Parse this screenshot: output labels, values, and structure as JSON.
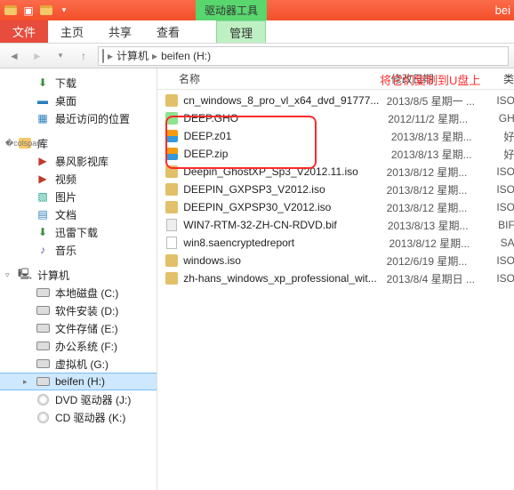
{
  "titlebar": {
    "context_tool": "驱动器工具",
    "right_text": "bei"
  },
  "ribbon": {
    "file": "文件",
    "tabs": [
      "主页",
      "共享",
      "查看"
    ],
    "manage": "管理"
  },
  "address": {
    "computer": "计算机",
    "folder": "beifen (H:)"
  },
  "annotation": "将它们复制到U盘上",
  "columns": {
    "name": "名称",
    "date": "修改日期",
    "type": "类"
  },
  "nav": {
    "quick": [
      {
        "icon": "dl",
        "label": "下载"
      },
      {
        "icon": "desk",
        "label": "桌面"
      },
      {
        "icon": "recent",
        "label": "最近访问的位置"
      }
    ],
    "lib_label": "库",
    "libs": [
      {
        "icon": "vid",
        "label": "暴风影视库"
      },
      {
        "icon": "vid",
        "label": "视频"
      },
      {
        "icon": "pic",
        "label": "图片"
      },
      {
        "icon": "doc",
        "label": "文档"
      },
      {
        "icon": "dl",
        "label": "迅雷下载"
      },
      {
        "icon": "mus",
        "label": "音乐"
      }
    ],
    "pc_label": "计算机",
    "drives": [
      {
        "icon": "drv",
        "label": "本地磁盘 (C:)"
      },
      {
        "icon": "drv",
        "label": "软件安装 (D:)"
      },
      {
        "icon": "drv",
        "label": "文件存储 (E:)"
      },
      {
        "icon": "drv",
        "label": "办公系统 (F:)"
      },
      {
        "icon": "drv",
        "label": "虚拟机 (G:)"
      },
      {
        "icon": "drv",
        "label": "beifen (H:)",
        "selected": true
      },
      {
        "icon": "dvd",
        "label": "DVD 驱动器 (J:)"
      },
      {
        "icon": "dvd",
        "label": "CD 驱动器 (K:)"
      }
    ]
  },
  "files": [
    {
      "icon": "disc",
      "name": "cn_windows_8_pro_vl_x64_dvd_91777...",
      "date": "2013/8/5 星期一 ...",
      "type": "ISO"
    },
    {
      "icon": "gho",
      "name": "DEEP.GHO",
      "date": "2012/11/2 星期...",
      "type": "GH"
    },
    {
      "icon": "zip",
      "name": "DEEP.z01",
      "date": "2013/8/13 星期...",
      "type": "好"
    },
    {
      "icon": "zip",
      "name": "DEEP.zip",
      "date": "2013/8/13 星期...",
      "type": "好"
    },
    {
      "icon": "disc",
      "name": "Deepin_GhostXP_Sp3_V2012.11.iso",
      "date": "2013/8/12 星期...",
      "type": "ISO"
    },
    {
      "icon": "disc",
      "name": "DEEPIN_GXPSP3_V2012.iso",
      "date": "2013/8/12 星期...",
      "type": "ISO"
    },
    {
      "icon": "disc",
      "name": "DEEPIN_GXPSP30_V2012.iso",
      "date": "2013/8/12 星期...",
      "type": "ISO"
    },
    {
      "icon": "bif",
      "name": "WIN7-RTM-32-ZH-CN-RDVD.bif",
      "date": "2013/8/13 星期...",
      "type": "BIF"
    },
    {
      "icon": "sa",
      "name": "win8.saencryptedreport",
      "date": "2013/8/12 星期...",
      "type": "SA"
    },
    {
      "icon": "disc",
      "name": "windows.iso",
      "date": "2012/6/19 星期...",
      "type": "ISO"
    },
    {
      "icon": "disc",
      "name": "zh-hans_windows_xp_professional_wit...",
      "date": "2013/8/4 星期日 ...",
      "type": "ISO"
    }
  ]
}
